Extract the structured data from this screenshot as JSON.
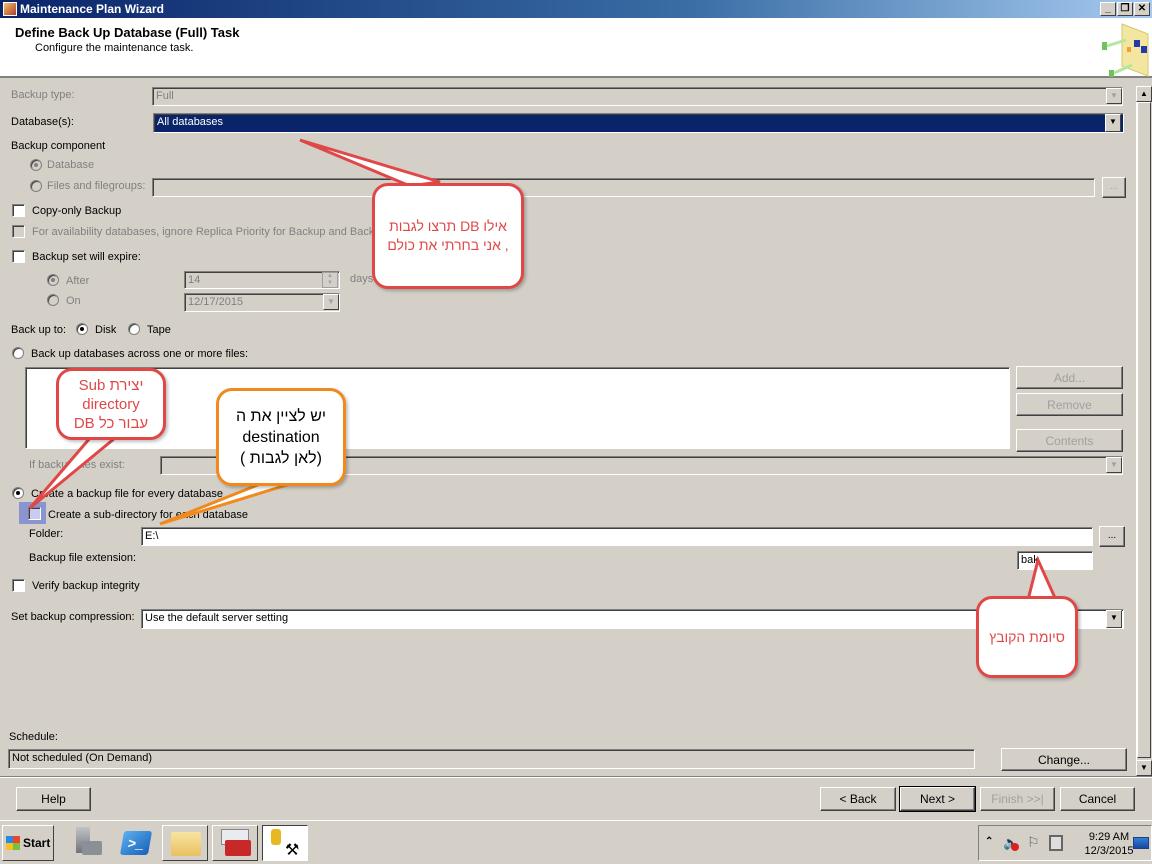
{
  "window": {
    "title": "Maintenance Plan Wizard",
    "controls": [
      "minimize",
      "restore",
      "close"
    ]
  },
  "header": {
    "title": "Define Back Up Database (Full) Task",
    "subtitle": "Configure the maintenance task."
  },
  "form": {
    "backup_type": {
      "label": "Backup type:",
      "value": "Full"
    },
    "databases": {
      "label": "Database(s):",
      "value": "All databases"
    },
    "backup_component": {
      "label": "Backup component",
      "database": "Database",
      "files": "Files and filegroups:",
      "files_browse": "..."
    },
    "copy_only": "Copy-only Backup",
    "availability": "For availability databases, ignore Replica Priority for Backup and Backup",
    "expire": {
      "label": "Backup set will expire:",
      "after_label": "After",
      "after_value": "14",
      "after_unit": "days",
      "on_label": "On",
      "on_value": "12/17/2015"
    },
    "backup_to": {
      "label": "Back up to:",
      "disk": "Disk",
      "tape": "Tape"
    },
    "across_files": {
      "label": "Back up databases across one or more files:",
      "add": "Add...",
      "remove": "Remove",
      "contents": "Contents",
      "if_exist_label": "If backup files exist:"
    },
    "every_db": {
      "label": "Create a backup file for every database",
      "subdir": "Create a sub-directory for each database",
      "folder_label": "Folder:",
      "folder_value": "E:\\",
      "folder_browse": "...",
      "ext_label": "Backup file extension:",
      "ext_value": "bak"
    },
    "verify": "Verify backup integrity",
    "compression": {
      "label": "Set backup compression:",
      "value": "Use the default server setting"
    },
    "schedule": {
      "label": "Schedule:",
      "value": "Not scheduled (On Demand)",
      "change": "Change..."
    }
  },
  "footer": {
    "help": "Help",
    "back": "< Back",
    "next": "Next >",
    "finish": "Finish >>|",
    "cancel": "Cancel"
  },
  "callouts": {
    "databases": [
      "אילו DB תרצו לגבות",
      ", אני בחרתי את כולם"
    ],
    "subdir": [
      "יצירת Sub",
      "directory",
      "עבור כל DB"
    ],
    "destination": [
      "יש לציין את ה",
      "destination",
      "(לאן לגבות )"
    ],
    "extension": [
      "סיומת הקובץ"
    ]
  },
  "taskbar": {
    "start": "Start",
    "apps": [
      "server-manager",
      "powershell",
      "explorer",
      "toolbox",
      "sql-management"
    ],
    "time": "9:29 AM",
    "date": "12/3/2015"
  }
}
